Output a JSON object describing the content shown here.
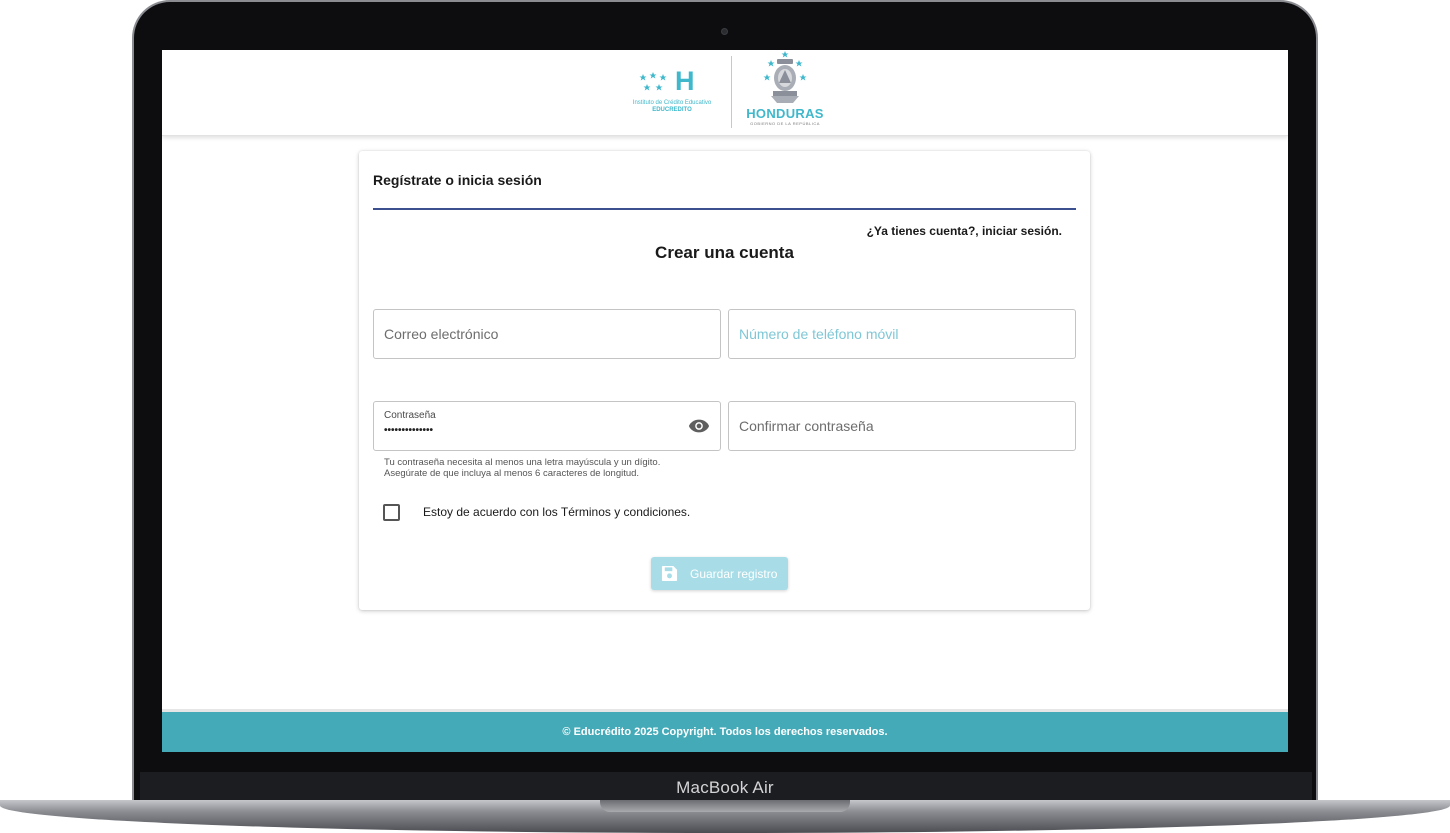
{
  "device": {
    "brand_label": "MacBook Air"
  },
  "header": {
    "institute_name": "Instituto de Crédito Educativo",
    "institute_short": "EDUCREDITO",
    "logo_letter": "H",
    "country": "HONDURAS",
    "country_sub": "GOBIERNO DE LA REPÚBLICA"
  },
  "card": {
    "title": "Regístrate o inicia sesión",
    "login_link": "¿Ya tienes cuenta?, iniciar sesión.",
    "heading": "Crear una cuenta",
    "email_placeholder": "Correo electrónico",
    "phone_placeholder": "Número de teléfono móvil",
    "password_label": "Contraseña",
    "password_value": "••••••••••••••",
    "confirm_placeholder": "Confirmar contraseña",
    "helper_line1": "Tu contraseña necesita al menos una letra mayúscula y un dígito.",
    "helper_line2": "Asegúrate de que incluya al menos 6 caracteres de longitud.",
    "terms_label": "Estoy de acuerdo con los Términos y condiciones.",
    "terms_checked": false,
    "save_label": "Guardar registro"
  },
  "footer": {
    "copyright": "© Educrédito 2025 Copyright. Todos los derechos reservados."
  },
  "colors": {
    "accent": "#3fb8cc",
    "footer": "#45aab8",
    "rule": "#3c4f8e",
    "button_disabled": "#a8dde7"
  },
  "icons": {
    "visibility": "eye-icon",
    "save": "floppy-disk-icon"
  }
}
